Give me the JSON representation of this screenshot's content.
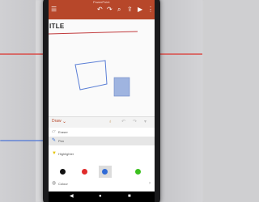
{
  "app": {
    "title": "PowerPoint",
    "accent": "#b7472a"
  },
  "slide": {
    "title": "ITLE",
    "ink_color": "#5b7fd6"
  },
  "ink_toolbar": {
    "draw_label": "Draw"
  },
  "ink_panel": {
    "items": [
      {
        "label": "Eraser",
        "icon": "eraser-icon"
      },
      {
        "label": "Pen",
        "icon": "pen-icon"
      },
      {
        "label": "Highlighter",
        "icon": "highlighter-icon"
      },
      {
        "label": "Colour",
        "icon": "color-icon"
      }
    ],
    "colors": [
      "#111111",
      "#e02b2b",
      "#2f6ad6",
      "#3cc01f"
    ],
    "selected_color": "#2f6ad6"
  }
}
